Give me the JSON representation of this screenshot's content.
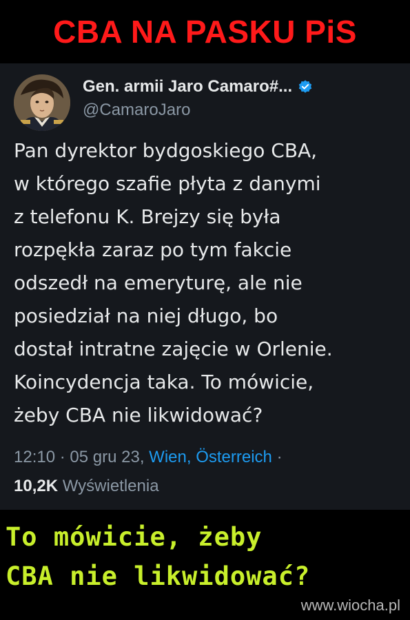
{
  "banner": {
    "title": "CBA NA PASKU PiS",
    "color": "#ff1a1a"
  },
  "tweet": {
    "author_name": "Gen. armii Jaro Camaro#...",
    "handle": "@CamaroJaro",
    "verified_icon": "verified-badge-icon",
    "body_lines": [
      "Pan dyrektor bydgoskiego CBA,",
      "w którego szafie płyta z danymi",
      "z telefonu K. Brejzy się była",
      "rozpękła zaraz po tym fakcie",
      "odszedł na emeryturę, ale nie",
      "posiedział na niej długo, bo",
      "dostał intratne zajęcie w Orlenie.",
      "Koincydencja taka. To mówicie,",
      "żeby CBA nie likwidować?"
    ],
    "time": "12:10",
    "date": "05 gru 23",
    "location": "Wien, Österreich",
    "views_count": "10,2K",
    "views_label": "Wyświetlenia",
    "accent": "#1d9bf0"
  },
  "caption": {
    "line1": "To mówicie, żeby",
    "line2": "CBA nie likwidować?",
    "color": "#c8ef2b"
  },
  "watermark": "www.wiocha.pl"
}
